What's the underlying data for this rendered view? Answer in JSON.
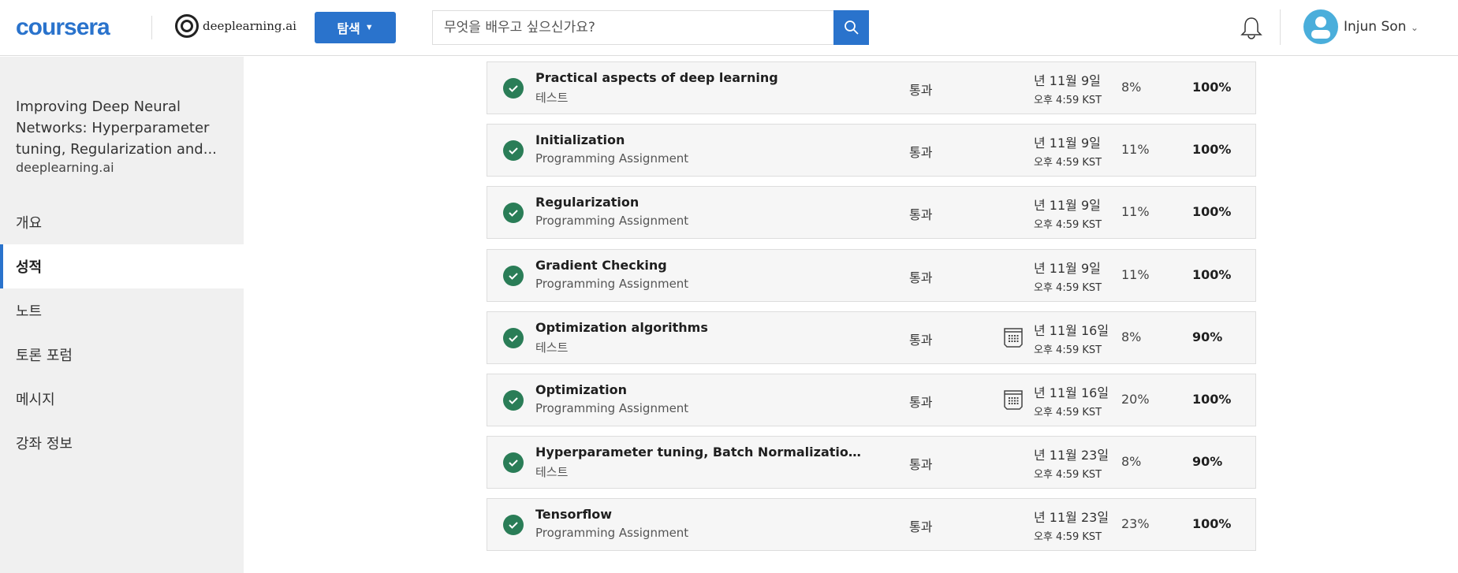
{
  "header": {
    "logo": "coursera",
    "partner_logo": "deeplearning.ai",
    "explore_label": "탐색",
    "search_placeholder": "무엇을 배우고 싶으신가요?",
    "user_name": "Injun Son"
  },
  "sidebar": {
    "course_title": "Improving Deep Neural Networks: Hyperparameter tuning, Regularization and...",
    "provider": "deeplearning.ai",
    "items": [
      {
        "label": "개요"
      },
      {
        "label": "성적",
        "active": true
      },
      {
        "label": "노트"
      },
      {
        "label": "토론 포럼"
      },
      {
        "label": "메시지"
      },
      {
        "label": "강좌 정보"
      }
    ]
  },
  "assignments": [
    {
      "title": "Practical aspects of deep learning",
      "type": "테스트",
      "status": "통과",
      "date": "년 11월 9일",
      "time": "오후 4:59 KST",
      "weight": "8%",
      "grade": "100%",
      "calendar": false
    },
    {
      "title": "Initialization",
      "type": "Programming Assignment",
      "status": "통과",
      "date": "년 11월 9일",
      "time": "오후 4:59 KST",
      "weight": "11%",
      "grade": "100%",
      "calendar": false
    },
    {
      "title": "Regularization",
      "type": "Programming Assignment",
      "status": "통과",
      "date": "년 11월 9일",
      "time": "오후 4:59 KST",
      "weight": "11%",
      "grade": "100%",
      "calendar": false
    },
    {
      "title": "Gradient Checking",
      "type": "Programming Assignment",
      "status": "통과",
      "date": "년 11월 9일",
      "time": "오후 4:59 KST",
      "weight": "11%",
      "grade": "100%",
      "calendar": false
    },
    {
      "title": "Optimization algorithms",
      "type": "테스트",
      "status": "통과",
      "date": "년 11월 16일",
      "time": "오후 4:59 KST",
      "weight": "8%",
      "grade": "90%",
      "calendar": true
    },
    {
      "title": "Optimization",
      "type": "Programming Assignment",
      "status": "통과",
      "date": "년 11월 16일",
      "time": "오후 4:59 KST",
      "weight": "20%",
      "grade": "100%",
      "calendar": true
    },
    {
      "title": "Hyperparameter tuning, Batch Normalization, Programming Frameworks",
      "type": "테스트",
      "status": "통과",
      "date": "년 11월 23일",
      "time": "오후 4:59 KST",
      "weight": "8%",
      "grade": "90%",
      "calendar": false
    },
    {
      "title": "Tensorflow",
      "type": "Programming Assignment",
      "status": "통과",
      "date": "년 11월 23일",
      "time": "오후 4:59 KST",
      "weight": "23%",
      "grade": "100%",
      "calendar": false
    }
  ],
  "colors": {
    "accent": "#2a73cc",
    "check": "#2a7d57",
    "avatar": "#4aaedb"
  }
}
